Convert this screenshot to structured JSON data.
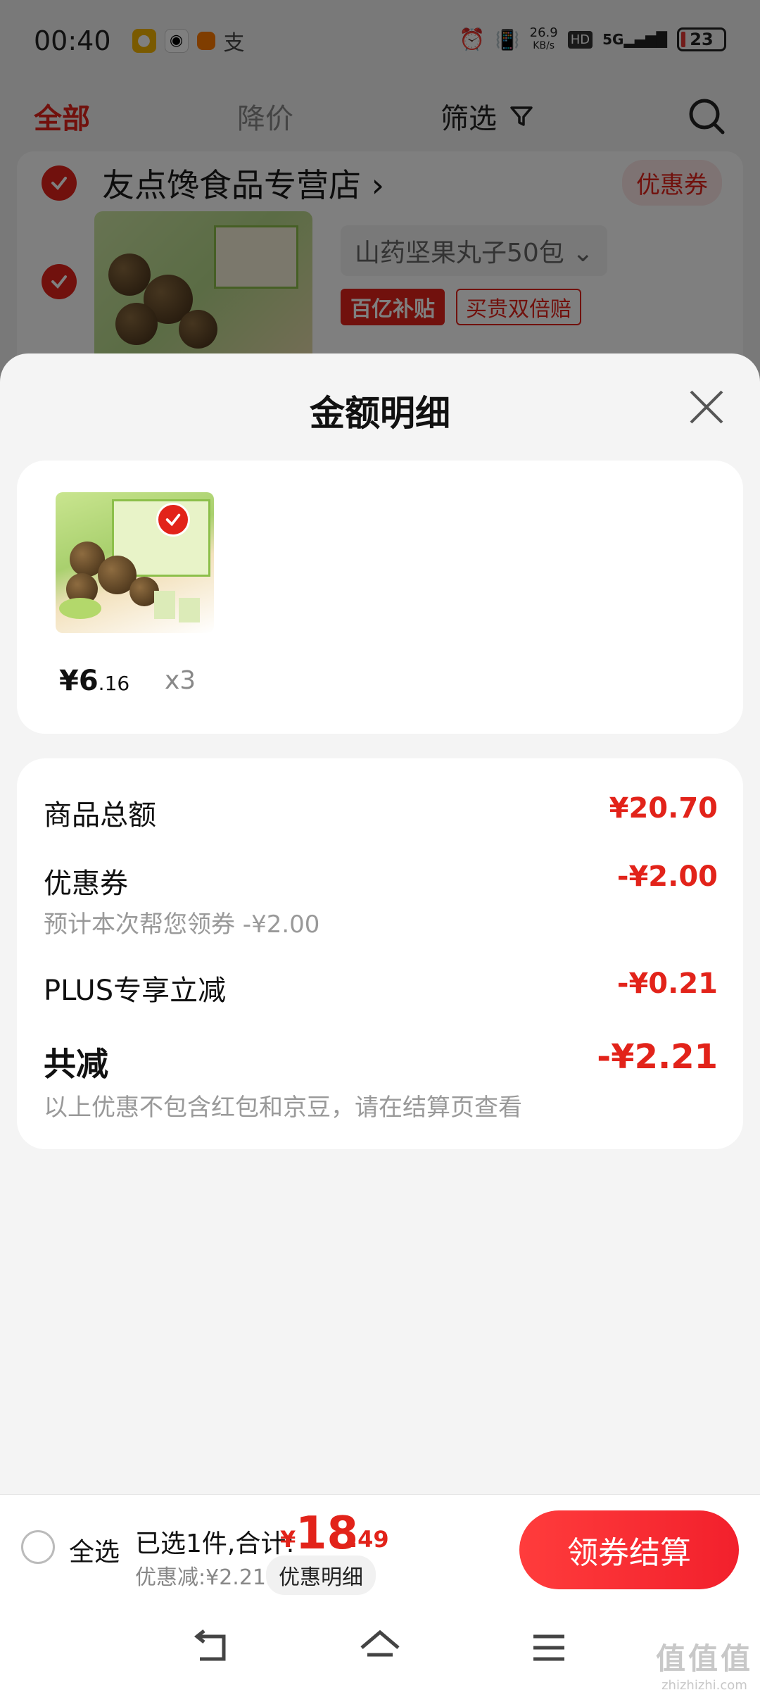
{
  "status_bar": {
    "time": "00:40",
    "speed": "26.9",
    "speed_unit": "KB/s",
    "hd": "HD",
    "network": "5G",
    "battery": "23"
  },
  "cart_tabs": {
    "all": "全部",
    "price_drop": "降价",
    "filter": "筛选"
  },
  "store": {
    "name": "友点馋食品专营店",
    "chevron": "›",
    "coupon": "优惠券",
    "sku": "山药坚果丸子50包",
    "badge_subsidy": "百亿补贴",
    "badge_double": "买贵双倍赔"
  },
  "sheet": {
    "title": "金额明细",
    "goods": {
      "price_int": "¥6",
      "price_dec": ".16",
      "qty": "x3"
    },
    "rows": {
      "goods_total_label": "商品总额",
      "goods_total_value": "¥20.70",
      "coupon_label": "优惠券",
      "coupon_value": "-¥2.00",
      "coupon_sub": "预计本次帮您领券 -¥2.00",
      "plus_label": "PLUS专享立减",
      "plus_value": "-¥0.21",
      "total_off_label": "共减",
      "total_off_value": "-¥2.21",
      "total_off_sub": "以上优惠不包含红包和京豆，请在结算页查看"
    }
  },
  "bottom_bar": {
    "select_all": "全选",
    "summary": "已选1件,合计:",
    "currency": "¥",
    "amount_int": "18",
    "amount_dec": ".49",
    "discount": "优惠减:¥2.21",
    "detail_button": "优惠明细",
    "checkout": "领券结算"
  },
  "watermark": {
    "big": "值值值",
    "small": "zhizhizhi.com"
  },
  "colors": {
    "accent": "#e2231a",
    "background": "#f4f4f4"
  }
}
